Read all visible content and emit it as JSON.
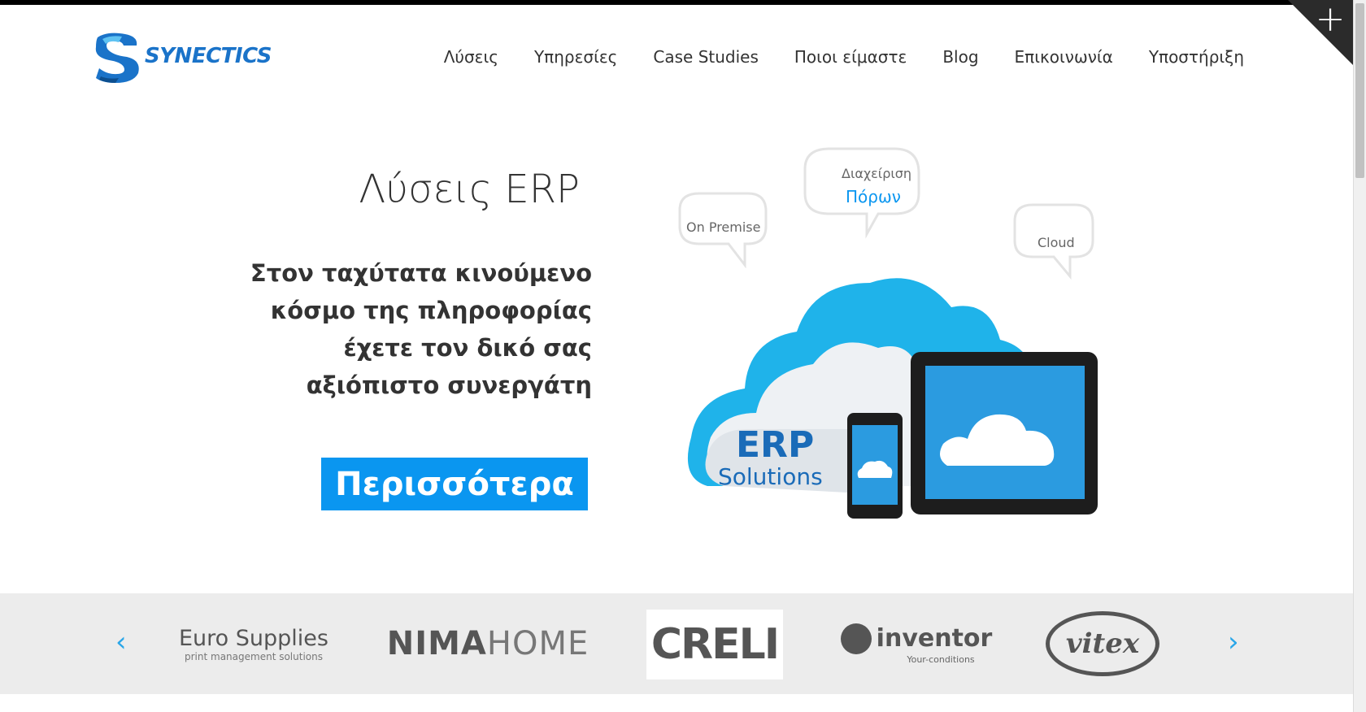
{
  "brand": {
    "name": "SYNECTICS",
    "accent": "#0a96f0",
    "logo_blue": "#1a73c9"
  },
  "nav": {
    "items": [
      {
        "label": "Λύσεις"
      },
      {
        "label": "Υπηρεσίες"
      },
      {
        "label": "Case Studies"
      },
      {
        "label": "Ποιοι είμαστε"
      },
      {
        "label": "Blog"
      },
      {
        "label": "Επικοινωνία"
      },
      {
        "label": "Υποστήριξη"
      }
    ]
  },
  "corner": {
    "icon": "plus-icon",
    "glyph": "+"
  },
  "hero": {
    "title_part1": "Λύσεις",
    "title_part2": "ERP",
    "subtitle_lines": [
      "Στον ταχύτατα κινούμενο",
      "κόσμο της πληροφορίας",
      "έχετε τον δικό σας",
      "αξιόπιστο συνεργάτη"
    ],
    "button_label": "Περισσότερα",
    "bubbles": {
      "on_premise": "On Premise",
      "management_line1": "Διαχείριση",
      "management_line2": "Πόρων",
      "cloud": "Cloud"
    },
    "image_text": {
      "erp": "ERP",
      "solutions": "Solutions"
    }
  },
  "clients": {
    "prev_icon": "chevron-left-icon",
    "next_icon": "chevron-right-icon",
    "prev_glyph": "‹",
    "next_glyph": "›",
    "logos": {
      "euro_main": "Euro Supplies",
      "euro_tag": "print management solutions",
      "nima_bold": "NIMA",
      "nima_light": "HOME",
      "creli": "CRELI",
      "inventor": "inventor",
      "inventor_tag": "Your-conditions",
      "vitex": "vitex"
    }
  }
}
